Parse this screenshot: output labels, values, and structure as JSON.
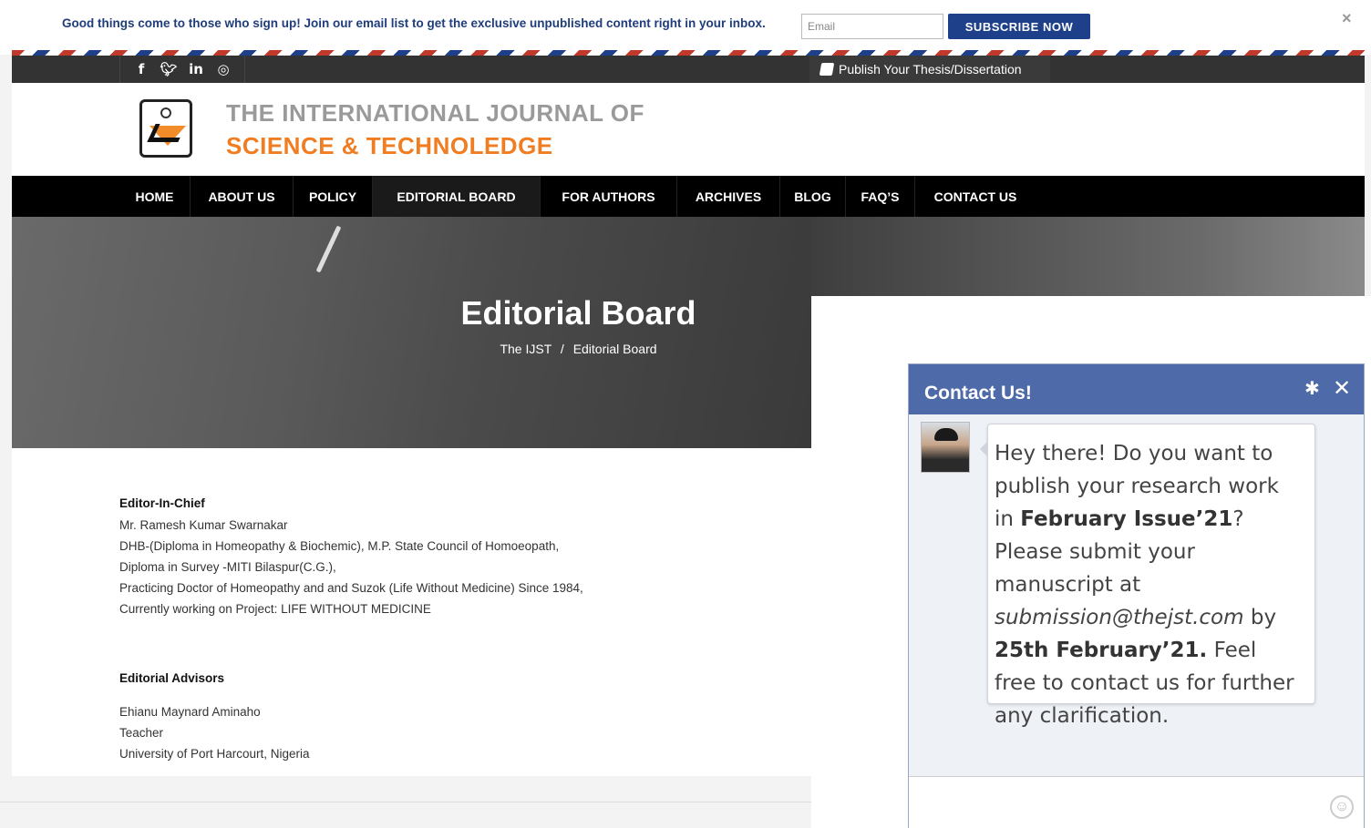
{
  "subscribe": {
    "message": "Good things come to those who sign up! Join our email list to get the exclusive unpublished content right in your inbox.",
    "email_placeholder": "Email",
    "button_label": "SUBSCRIBE NOW",
    "close_label": "×"
  },
  "topbar": {
    "social": [
      "f",
      "t",
      "in",
      "ig"
    ],
    "publish_label": "Publish Your Thesis/Dissertation"
  },
  "logo": {
    "line1": "THE INTERNATIONAL JOURNAL OF",
    "line2": "SCIENCE & TECHNOLEDGE"
  },
  "nav": {
    "items": [
      "HOME",
      "ABOUT US",
      "POLICY",
      "EDITORIAL BOARD",
      "FOR AUTHORS",
      "ARCHIVES",
      "BLOG",
      "FAQ’S",
      "CONTACT US"
    ],
    "active": "EDITORIAL BOARD"
  },
  "hero": {
    "title": "Editorial Board",
    "breadcrumb_home": "The IJST",
    "breadcrumb_sep": "/",
    "breadcrumb_current": "Editorial Board"
  },
  "content": {
    "eic_heading": "Editor-In-Chief",
    "eic_lines": [
      "Mr. Ramesh Kumar Swarnakar",
      "DHB-(Diploma in Homeopathy & Biochemic), M.P. State Council of Homoeopath,",
      "Diploma in Survey -MITI Bilaspur(C.G.),",
      "Practicing Doctor of Homeopathy and and Suzok (Life Without Medicine) Since 1984,",
      "Currently working on Project: LIFE WITHOUT MEDICINE"
    ],
    "advisors_heading": "Editorial Advisors",
    "advisor_lines": [
      "Ehianu Maynard Aminaho",
      "Teacher",
      "University of Port Harcourt, Nigeria"
    ]
  },
  "chat": {
    "title": "Contact Us!",
    "gear": "✱",
    "close": "✕",
    "msg_part1": "Hey there! Do you want to publish your research work in ",
    "msg_bold1": "February Issue’21",
    "msg_part2": "? Please submit your manuscript at ",
    "msg_email": "submission@thejst.com",
    "msg_part3": " by ",
    "msg_bold2": "25th February’21.",
    "msg_part4": " Feel free to contact us for further any clarification.",
    "smiley": "☺"
  },
  "colors": {
    "brand_blue": "#1e3f8a",
    "logo_orange": "#f07d22",
    "chat_header": "#4e6aa8"
  }
}
